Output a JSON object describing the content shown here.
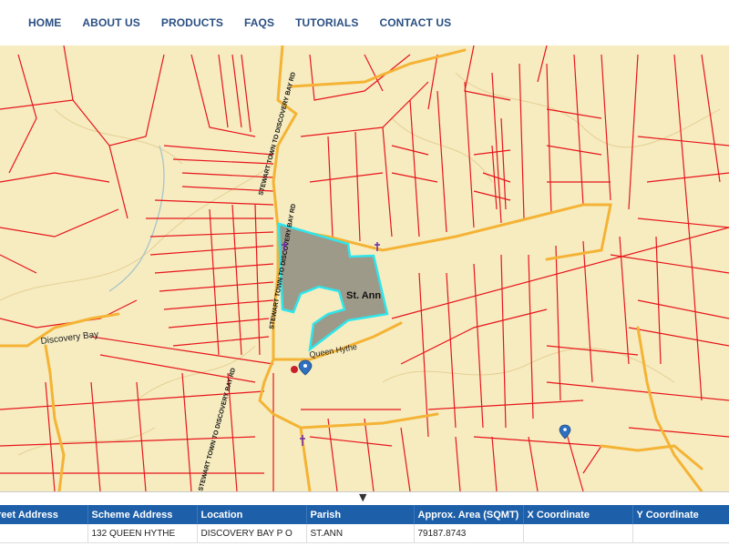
{
  "nav": {
    "items": [
      "HOME",
      "ABOUT US",
      "PRODUCTS",
      "FAQS",
      "TUTORIALS",
      "CONTACT US"
    ]
  },
  "map": {
    "labels": {
      "st_ann": "St. Ann",
      "discovery_bay": "Discovery Bay",
      "queen_hythe": "Queen Hythe",
      "road_upper": "STEWART TOWN TO DISCOVERY BAY RD",
      "road_middle": "STEWART TOWN TO DISCOVERY BAY RD",
      "road_lower": "STEWART TOWN TO DISCOVERY BAY RD"
    },
    "colors": {
      "background": "#f6ecc0",
      "parcel_lines": "#e8141b",
      "roads": "#f5b335",
      "selected_fill": "#9e9a8a",
      "selected_outline": "#2ee6ec"
    }
  },
  "panel_toggle": "▼",
  "table": {
    "headers": [
      "Street Address",
      "Scheme Address",
      "Location",
      "Parish",
      "Approx. Area (SQMT)",
      "X Coordinate",
      "Y Coordinate"
    ],
    "rows": [
      [
        "",
        "132 QUEEN HYTHE",
        "DISCOVERY BAY P O",
        "ST.ANN",
        "79187.8743",
        "",
        ""
      ]
    ]
  }
}
